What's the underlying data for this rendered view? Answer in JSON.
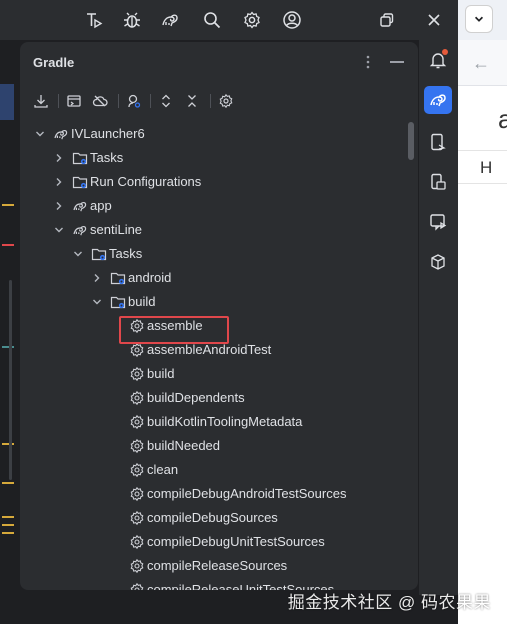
{
  "panel": {
    "title": "Gradle"
  },
  "tree": [
    {
      "label": "IVLauncher6",
      "icon": "gradle-elephant-icon",
      "expanded": true
    },
    {
      "label": "Tasks",
      "icon": "folder-icon",
      "expanded": false
    },
    {
      "label": "Run Configurations",
      "icon": "folder-icon",
      "expanded": false
    },
    {
      "label": "app",
      "icon": "gradle-elephant-icon",
      "expanded": false
    },
    {
      "label": "sentiLine",
      "icon": "gradle-elephant-icon",
      "expanded": true
    },
    {
      "label": "Tasks",
      "icon": "folder-icon",
      "expanded": true
    },
    {
      "label": "android",
      "icon": "folder-icon",
      "expanded": false
    },
    {
      "label": "build",
      "icon": "folder-icon",
      "expanded": true
    },
    {
      "label": "assemble",
      "icon": "gear-icon",
      "highlighted": true
    },
    {
      "label": "assembleAndroidTest",
      "icon": "gear-icon"
    },
    {
      "label": "build",
      "icon": "gear-icon"
    },
    {
      "label": "buildDependents",
      "icon": "gear-icon"
    },
    {
      "label": "buildKotlinToolingMetadata",
      "icon": "gear-icon"
    },
    {
      "label": "buildNeeded",
      "icon": "gear-icon"
    },
    {
      "label": "clean",
      "icon": "gear-icon"
    },
    {
      "label": "compileDebugAndroidTestSources",
      "icon": "gear-icon"
    },
    {
      "label": "compileDebugSources",
      "icon": "gear-icon"
    },
    {
      "label": "compileDebugUnitTestSources",
      "icon": "gear-icon"
    },
    {
      "label": "compileReleaseSources",
      "icon": "gear-icon"
    },
    {
      "label": "compileReleaseUnitTestSources",
      "icon": "gear-icon"
    }
  ],
  "browser": {
    "back_glyph": "←",
    "heading_fragment": "a",
    "cell_fragment": "H"
  },
  "watermark": "掘金技术社区 @ 码农果果",
  "colors": {
    "highlight_border": "#e0474b",
    "accent": "#3574f0",
    "notification": "#e55b3c"
  }
}
